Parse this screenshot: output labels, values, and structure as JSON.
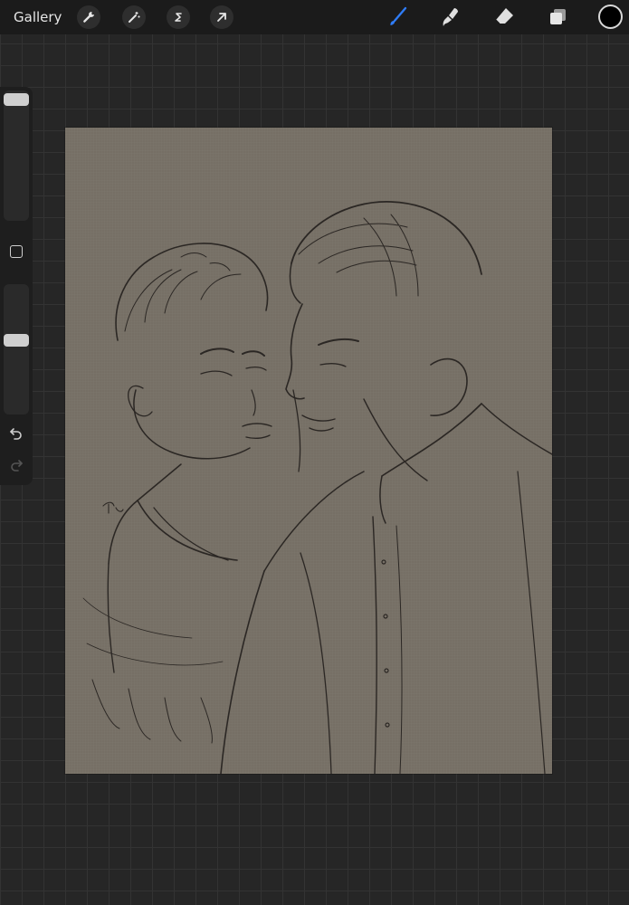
{
  "toolbar": {
    "gallery_label": "Gallery",
    "actions_icon": "wrench-icon",
    "adjustments_icon": "magic-wand-icon",
    "selection_icon": "selection-s-icon",
    "transform_icon": "arrow-cursor-icon",
    "brush_icon": "brush-icon",
    "smudge_icon": "smudge-icon",
    "eraser_icon": "eraser-icon",
    "layers_icon": "layers-icon",
    "active_color": "#000000",
    "active_tool_color": "#2f7cf6"
  },
  "sidebar": {
    "brush_size_level": 0.05,
    "opacity_level": 0.4,
    "undo_icon": "undo-icon",
    "redo_icon": "redo-icon"
  },
  "canvas": {
    "signature_text": "R25"
  }
}
